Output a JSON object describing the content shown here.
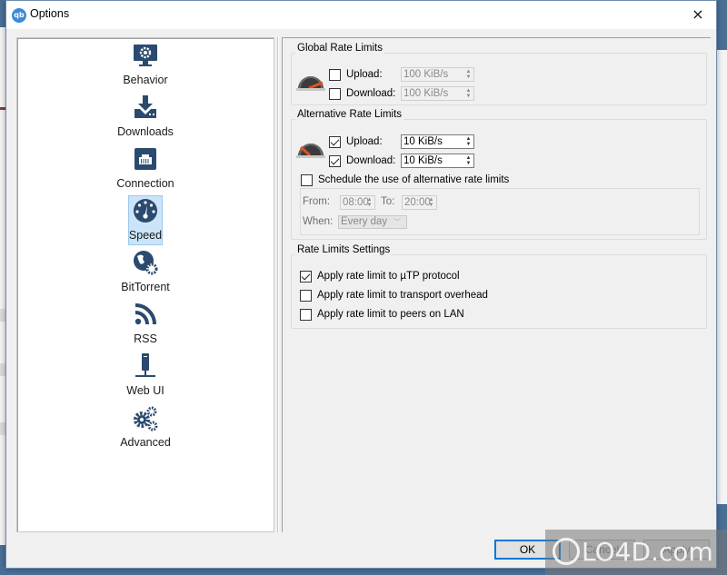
{
  "window": {
    "title": "Options",
    "app_logo_text": "qb",
    "close_icon": "×"
  },
  "sidebar": {
    "selected": "Speed",
    "items": [
      {
        "label": "Behavior",
        "icon": "monitor-gear-icon"
      },
      {
        "label": "Downloads",
        "icon": "download-tray-icon"
      },
      {
        "label": "Connection",
        "icon": "ethernet-port-icon"
      },
      {
        "label": "Speed",
        "icon": "speedometer-icon"
      },
      {
        "label": "BitTorrent",
        "icon": "globe-gear-icon"
      },
      {
        "label": "RSS",
        "icon": "rss-feed-icon"
      },
      {
        "label": "Web UI",
        "icon": "network-server-icon"
      },
      {
        "label": "Advanced",
        "icon": "gears-icon"
      }
    ]
  },
  "global_rate_limits": {
    "title": "Global Rate Limits",
    "upload": {
      "label": "Upload:",
      "checked": false,
      "value": "100 KiB/s",
      "enabled": false
    },
    "download": {
      "label": "Download:",
      "checked": false,
      "value": "100 KiB/s",
      "enabled": false
    }
  },
  "alternative_rate_limits": {
    "title": "Alternative Rate Limits",
    "upload": {
      "label": "Upload:",
      "checked": true,
      "value": "10 KiB/s",
      "enabled": true
    },
    "download": {
      "label": "Download:",
      "checked": true,
      "value": "10 KiB/s",
      "enabled": true
    },
    "schedule": {
      "label": "Schedule the use of alternative rate limits",
      "checked": false,
      "from_label": "From:",
      "from_value": "08:00",
      "to_label": "To:",
      "to_value": "20:00",
      "when_label": "When:",
      "when_value": "Every day"
    }
  },
  "rate_limits_settings": {
    "title": "Rate Limits Settings",
    "options": [
      {
        "label": "Apply rate limit to µTP protocol",
        "checked": true
      },
      {
        "label": "Apply rate limit to transport overhead",
        "checked": false
      },
      {
        "label": "Apply rate limit to peers on LAN",
        "checked": false
      }
    ]
  },
  "buttons": {
    "ok": "OK",
    "cancel": "Cancel",
    "apply": "Apply"
  },
  "watermark": {
    "text": "LO4D.com"
  },
  "colors": {
    "accent": "#0078d7",
    "icon_blue": "#2b4a6f",
    "selection_bg": "#cce4f7",
    "gauge_needle": "#e8501e"
  }
}
